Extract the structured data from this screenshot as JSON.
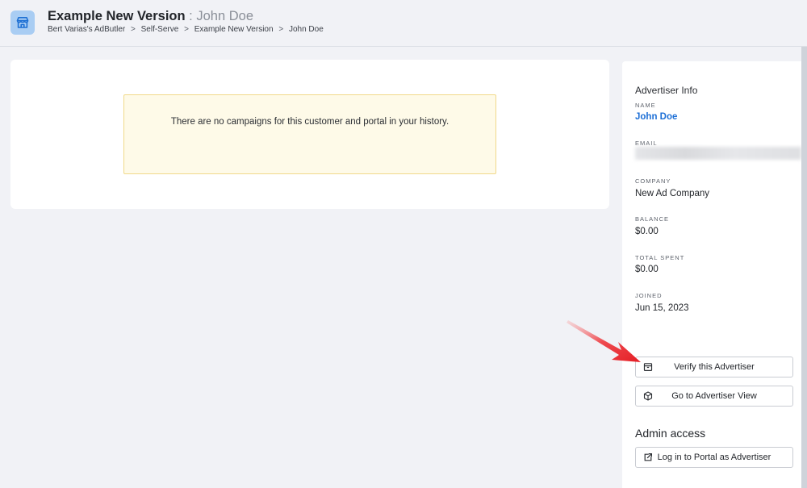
{
  "header": {
    "title": "Example New Version",
    "title_separator": ":",
    "subtitle": "John Doe",
    "breadcrumb": [
      "Bert Varias's AdButler",
      "Self-Serve",
      "Example New Version",
      "John Doe"
    ],
    "breadcrumb_separator": ">",
    "icon": "store-icon"
  },
  "main": {
    "notice": "There are no campaigns for this customer and portal in your history."
  },
  "advertiser": {
    "panel_title": "Advertiser Info",
    "name_label": "NAME",
    "name": "John Doe",
    "email_label": "EMAIL",
    "company_label": "COMPANY",
    "company": "New Ad Company",
    "balance_label": "BALANCE",
    "balance": "$0.00",
    "total_spent_label": "TOTAL SPENT",
    "total_spent": "$0.00",
    "joined_label": "JOINED",
    "joined": "Jun 15, 2023"
  },
  "actions": {
    "verify_label": "Verify this Advertiser",
    "verify_icon": "archive-box-icon",
    "advertiser_view_label": "Go to Advertiser View",
    "advertiser_view_icon": "cube-icon"
  },
  "admin": {
    "heading": "Admin access",
    "login_label": "Log in to Portal as Advertiser",
    "login_icon": "external-link-icon"
  },
  "colors": {
    "accent_link": "#1d6fd6",
    "notice_bg": "#fefae8",
    "notice_border": "#f1d98a",
    "annotation_arrow": "#e8252b"
  }
}
